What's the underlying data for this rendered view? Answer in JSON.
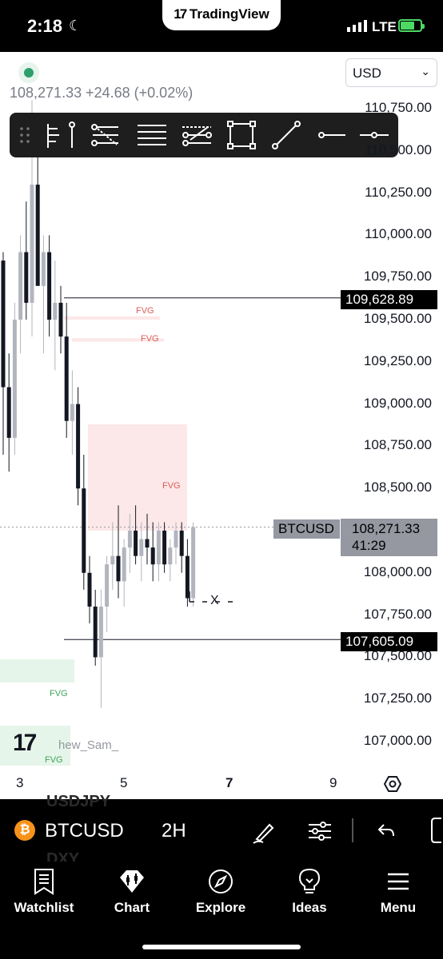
{
  "status": {
    "time": "2:18",
    "network": "LTE",
    "app_name": "TradingView",
    "battery_level": 0.7
  },
  "symbol_info": {
    "price": "108,271.33",
    "change": "+24.68 (+0.02%)"
  },
  "currency": {
    "value": "USD"
  },
  "price_axis": [
    "110,750.00",
    "110,500.00",
    "110,250.00",
    "110,000.00",
    "109,750.00",
    "109,500.00",
    "109,250.00",
    "109,000.00",
    "108,750.00",
    "108,500.00",
    "108,250.00",
    "108,000.00",
    "107,750.00",
    "107,500.00",
    "107,250.00",
    "107,000.00"
  ],
  "markers": {
    "upper_line": "109,628.89",
    "lower_line": "107,605.09",
    "symbol_tag": "BTCUSD",
    "current_price": "108,271.33",
    "countdown": "41:29"
  },
  "fvg_zones": [
    "FVG",
    "FVG",
    "FVG",
    "FVG",
    "FVG"
  ],
  "watermark": {
    "author": "hew_Sam_"
  },
  "x_axis": [
    "3",
    "5",
    "7",
    "9"
  ],
  "position_label": "X",
  "bottom_bar": {
    "symbol": "BTCUSD",
    "interval": "2H",
    "ghost_top": "USDJPY",
    "ghost_bottom": "DXY"
  },
  "tabs": [
    {
      "label": "Watchlist",
      "icon": "watchlist-icon"
    },
    {
      "label": "Chart",
      "icon": "chart-icon"
    },
    {
      "label": "Explore",
      "icon": "compass-icon"
    },
    {
      "label": "Ideas",
      "icon": "lightbulb-icon"
    },
    {
      "label": "Menu",
      "icon": "menu-icon"
    }
  ],
  "colors": {
    "accent_green": "#2e9e6c",
    "fvg_red": "#e05a5a",
    "fvg_green": "#3ea45a",
    "bitcoin": "#f7931a"
  },
  "chart_data": {
    "type": "candlestick",
    "symbol": "BTCUSD",
    "interval": "2H",
    "candles": [
      [
        109850,
        109900,
        108700,
        109100
      ],
      [
        109100,
        109300,
        108600,
        108800
      ],
      [
        108800,
        109600,
        108700,
        109500
      ],
      [
        109500,
        110000,
        109300,
        109900
      ],
      [
        109900,
        110200,
        109500,
        109600
      ],
      [
        109600,
        110800,
        109400,
        110300
      ],
      [
        110300,
        110700,
        109800,
        109700
      ],
      [
        109700,
        110000,
        109300,
        109900
      ],
      [
        109900,
        110000,
        109400,
        109500
      ],
      [
        109500,
        109850,
        109200,
        109600
      ],
      [
        109600,
        109700,
        109300,
        109400
      ],
      [
        109400,
        109600,
        108800,
        108900
      ],
      [
        108900,
        109200,
        108700,
        109000
      ],
      [
        109000,
        109100,
        108400,
        108500
      ],
      [
        108500,
        108700,
        107900,
        108000
      ],
      [
        108000,
        108100,
        107700,
        107800
      ],
      [
        107800,
        107900,
        107450,
        107500
      ],
      [
        107500,
        107900,
        107200,
        107800
      ],
      [
        107800,
        108100,
        107650,
        108050
      ],
      [
        108050,
        108300,
        107900,
        108100
      ],
      [
        108100,
        108400,
        107850,
        107950
      ],
      [
        107950,
        108200,
        107800,
        108150
      ],
      [
        108150,
        108350,
        108000,
        108250
      ],
      [
        108250,
        108400,
        108050,
        108100
      ],
      [
        108100,
        108300,
        107950,
        108200
      ],
      [
        108200,
        108350,
        108050,
        108150
      ],
      [
        108150,
        108300,
        107950,
        108050
      ],
      [
        108050,
        108300,
        107950,
        108250
      ],
      [
        108250,
        108300,
        108000,
        108050
      ],
      [
        108050,
        108200,
        107950,
        108150
      ],
      [
        108150,
        108300,
        108050,
        108250
      ],
      [
        108250,
        108300,
        108000,
        108100
      ],
      [
        108100,
        108200,
        107800,
        107850
      ],
      [
        107850,
        108300,
        107800,
        108271
      ]
    ],
    "ylim": [
      107000,
      110750
    ],
    "horizontal_lines": [
      109628.89,
      107605.09
    ],
    "fvg_zones": [
      [
        109500,
        109520
      ],
      [
        109370,
        109390
      ],
      [
        108250,
        108880
      ]
    ]
  }
}
